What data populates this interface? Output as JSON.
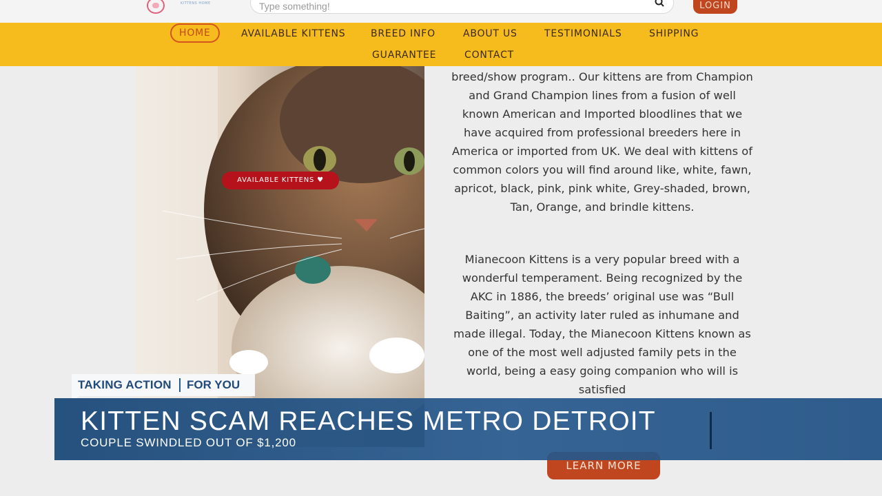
{
  "header": {
    "logo_icon": "cat-logo-icon",
    "logo_subtext": "KITTENS HOME",
    "search": {
      "placeholder": "Type something!",
      "icon": "search-icon"
    },
    "login_label": "LOGIN"
  },
  "nav": {
    "items": [
      {
        "label": "HOME",
        "active": true
      },
      {
        "label": "AVAILABLE KITTENS"
      },
      {
        "label": "BREED INFO"
      },
      {
        "label": "ABOUT US"
      },
      {
        "label": "TESTIMONIALS"
      },
      {
        "label": "SHIPPING"
      },
      {
        "label": "GUARANTEE"
      },
      {
        "label": "CONTACT"
      }
    ]
  },
  "hero": {
    "badge_label": "AVAILABLE KITTENS",
    "badge_icon": "heart-icon"
  },
  "article": {
    "paragraph1": "breed/show program.. Our kittens are from Champion and Grand Champion lines from a fusion of well known American and Imported bloodlines that we have acquired from professional breeders here in America or imported from UK. We deal with kittens of common colors you will find around like, white, fawn, apricot, black, pink, pink white, Grey-shaded, brown, Tan, Orange, and brindle kittens.",
    "paragraph2": "Mianecoon Kittens is a very popular breed with a wonderful temperament. Being recognized by the AKC in 1886, the breeds’ original use was “Bull Baiting”, an activity later ruled as inhumane and made illegal. Today, the Mianecoon Kittens known as one of the most well adjusted family pets in the world, being a easy going companion who will is satisfied",
    "learn_more_label": "LEARN MORE"
  },
  "broadcast": {
    "tag_left": "TAKING ACTION",
    "tag_right": "FOR YOU",
    "headline": "KITTEN SCAM REACHES METRO DETROIT",
    "subheadline": "COUPLE SWINDLED OUT OF $1,200"
  },
  "colors": {
    "nav_bg": "#f6bb1d",
    "button_orange": "#c0461f",
    "badge_red": "#b5121b",
    "lower_third_blue": "#1e4b7a"
  }
}
